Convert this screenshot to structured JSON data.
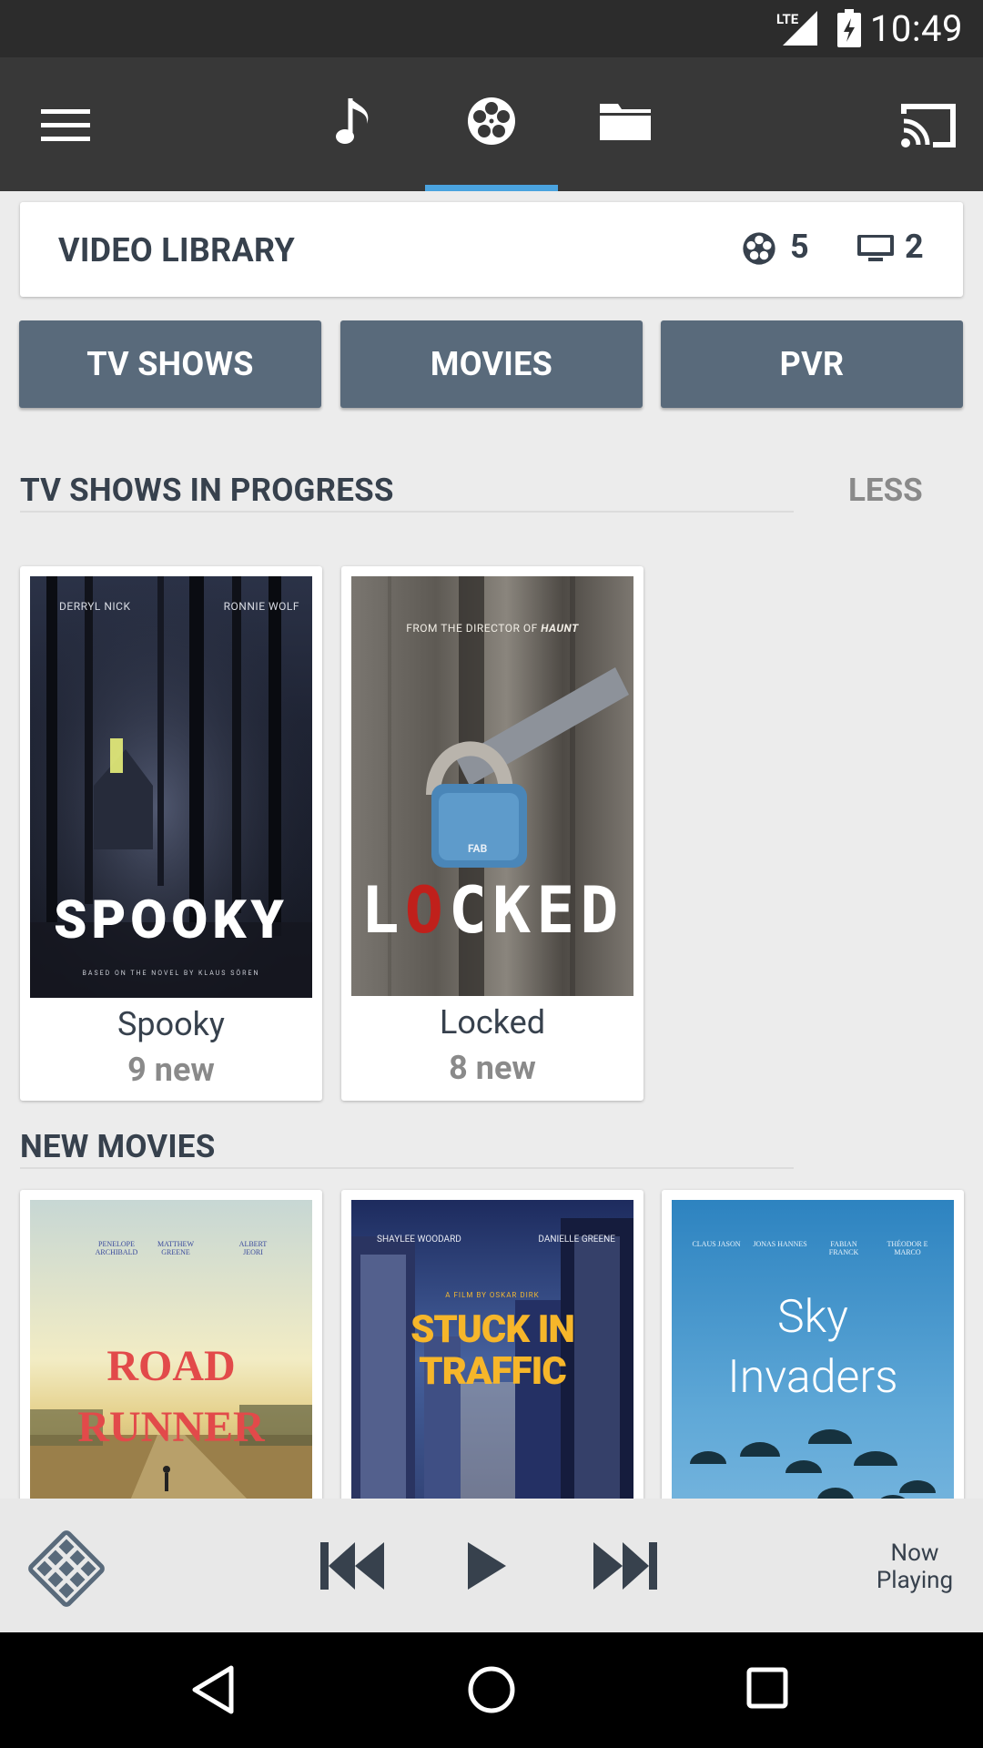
{
  "status_bar": {
    "network": "LTE",
    "time": "10:49"
  },
  "app_bar": {
    "menu_icon": "menu-icon",
    "tabs": [
      {
        "name": "music",
        "icon": "music-note-icon"
      },
      {
        "name": "video",
        "icon": "film-reel-icon",
        "selected": true
      },
      {
        "name": "files",
        "icon": "folder-icon"
      }
    ],
    "cast_icon": "cast-icon",
    "accent_color": "#4aa3df"
  },
  "library": {
    "title": "VIDEO LIBRARY",
    "movies_count": "5",
    "tv_count": "2"
  },
  "buttons": {
    "tv_shows": "TV SHOWS",
    "movies": "MOVIES",
    "pvr": "PVR"
  },
  "in_progress": {
    "title": "TV SHOWS IN PROGRESS",
    "toggle": "LESS",
    "items": [
      {
        "name": "Spooky",
        "sub": "9 new",
        "poster": {
          "top_left": "DERRYL NICK",
          "top_right": "RONNIE WOLF",
          "title": "SPOOKY",
          "footer": "BASED ON THE NOVEL BY KLAUS SÖREN"
        }
      },
      {
        "name": "Locked",
        "sub": "8 new",
        "poster": {
          "tagline_prefix": "FROM THE DIRECTOR OF ",
          "tagline_title": "HAUNT",
          "title_l": "L",
          "title_o": "O",
          "title_rest": "CKED",
          "lock_label": "FAB"
        }
      }
    ]
  },
  "new_movies": {
    "title": "NEW MOVIES",
    "items": [
      {
        "credits": [
          "PENELOPE ARCHIBALD",
          "MATTHEW GREENE",
          "ALBERT JEORI"
        ],
        "line1": "ROAD",
        "line2": "RUNNER"
      },
      {
        "credit_left": "SHAYLEE WOODARD",
        "credit_right": "DANIELLE GREENE",
        "byline": "A FILM BY OSKAR DIRK",
        "line1": "STUCK IN",
        "line2": "TRAFFIC"
      },
      {
        "credits": [
          "CLAUS JASON",
          "JONAS HANNES",
          "FABIAN FRANCK",
          "THÉODOR E MARCO"
        ],
        "line1": "Sky",
        "line2": "Invaders"
      }
    ]
  },
  "now_playing": {
    "label_line1": "Now",
    "label_line2": "Playing"
  }
}
